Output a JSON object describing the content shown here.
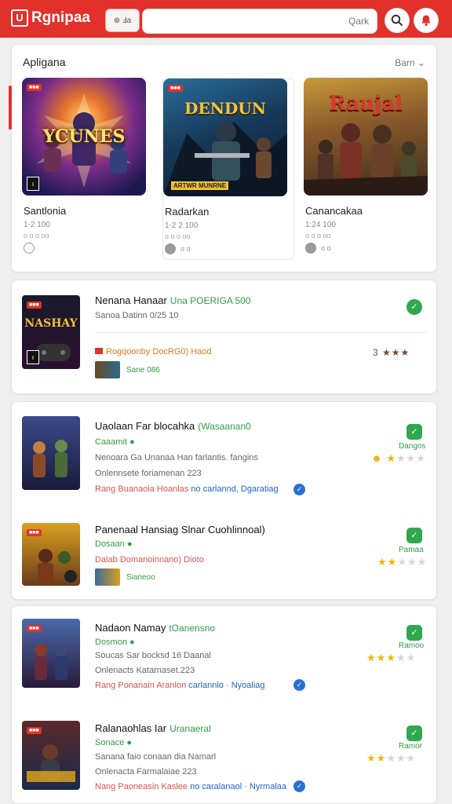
{
  "header": {
    "app_name": "Rgnipaa",
    "logo_glyph": "U",
    "search_prefix": "⊕ Ⅎa",
    "search_placeholder": "Qark",
    "brand_color": "#e2312a"
  },
  "featured": {
    "title": "Apligana",
    "more_label": "Barn ⌄",
    "items": [
      {
        "name": "Santlonia",
        "meta": "1-2 100",
        "sub": "ɑ ɑ ɑ ɑɑ",
        "foot": "",
        "art_text": "YCUNES"
      },
      {
        "name": "Radarkan",
        "meta": "1-2 2 100",
        "sub": "ɑ ɑ ɑ ɑɑ",
        "foot": "ɑ ɑ",
        "art_text": "DENDUN"
      },
      {
        "name": "Canancakaa",
        "meta": "1:24 100",
        "sub": "ɑ ɑ ɑ ɑɑ",
        "foot": "ɑ ɑ",
        "art_text": "Raujal"
      }
    ]
  },
  "list": [
    {
      "title": "Nenana Hanaar",
      "tag": "Una POERIGA 500",
      "line1": "Sanoa Datinn 0/25 10",
      "promo": "Rogqoonby DocRG0) Haod",
      "rating": "3 ★★★",
      "mini": "Sane 086",
      "thumb_text": "NASHAY"
    },
    {
      "title": "Uaolaan Far blocahka",
      "tag": "(Wasaanan0",
      "line1": "Caaamit ●",
      "line2": "Nenoara Ga Unanaa Han farlantis. fangins",
      "line3": "Onlennsete foriamenan 223",
      "line4_a": "Rang",
      "line4_b": "Buanaoia Hoanlas",
      "line4_c": "no carlannd,  Dgaratiag",
      "check_label": "Dangos"
    },
    {
      "title": "Panenaal Hansiag Slnar Cuohlinnoal)",
      "line1": "Dosaan ●",
      "line2_a": "Dalab",
      "line2_b": "Domanoinnano) Dioto",
      "mini": "Sianeoo",
      "check_label": "Pamaa"
    },
    {
      "title": "Nadaon Namay",
      "tag": "tOanensno",
      "line1": "Dosmon ●",
      "line2": "Soucas Sar bocksd 16 Daanal",
      "line3": "Onlenacts Katarnaset.223",
      "line4_a": "Rang",
      "line4_b": "Ponanain Aranlon",
      "line4_c": "carlannio  · Nyoaliag",
      "check_label": "Ramoo"
    },
    {
      "title": "Ralanaohlas Iar",
      "tag": "Uranaeral",
      "line1": "Sonace ●",
      "line2": "Sanana faio conaan dia Namarl",
      "line3": "Onlenacta Farmalaiae 223",
      "line4_a": "Nang",
      "line4_b": "Paoneasin Kaslee",
      "line4_c": "no caralanaol · Nyrmalaa",
      "check_label": "Ramor"
    }
  ]
}
